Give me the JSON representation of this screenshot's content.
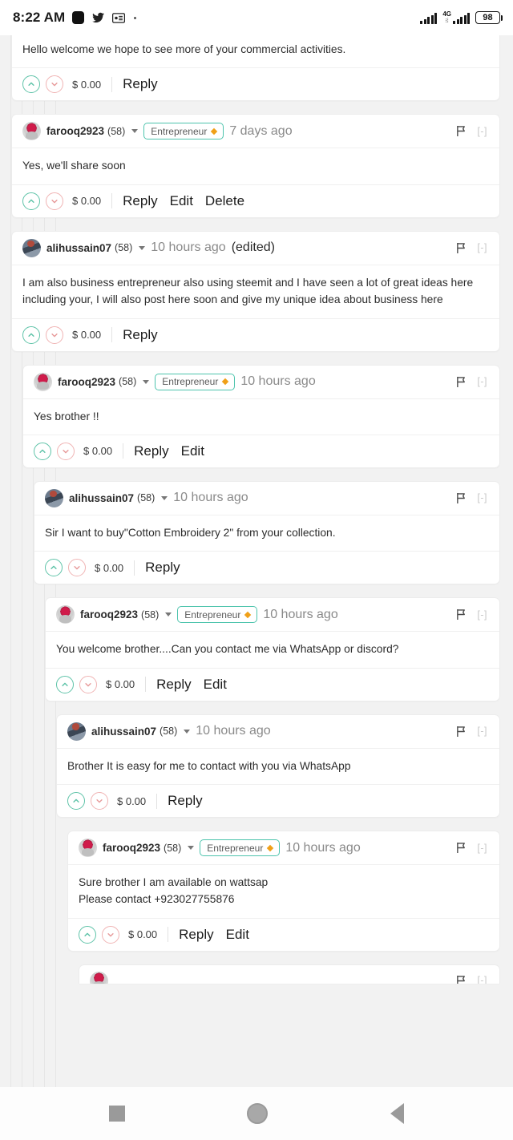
{
  "status_bar": {
    "time": "8:22 AM",
    "battery_percent": "98",
    "network_type": "4G",
    "network_sub": "LTE",
    "icons": [
      "app-square-icon",
      "twitter-icon",
      "id-card-icon",
      "dot-icon"
    ]
  },
  "nav_bar": {
    "recents_label": "recents-button",
    "home_label": "home-button",
    "back_label": "back-button"
  },
  "ui_labels": {
    "reply": "Reply",
    "edit": "Edit",
    "delete": "Delete",
    "collapse": "[-]",
    "flag": "flag-icon",
    "upvote": "upvote-icon",
    "downvote": "downvote-icon",
    "badge_text": "Entrepreneur",
    "edited_tag": "(edited)"
  },
  "colors": {
    "accent_teal": "#4ec4ad",
    "badge_diamond": "#f0a018",
    "upvote_border": "#5ec3a8",
    "downvote_border": "#f0b3b3",
    "page_bg": "#f2f2f2",
    "card_bg": "#ffffff"
  },
  "comments": [
    {
      "id": "c0",
      "partial_top": true,
      "indent": 0,
      "body": "Hello welcome we hope to see more of your commercial activities.",
      "payout": "$ 0.00",
      "actions": [
        "Reply"
      ]
    },
    {
      "id": "c1",
      "indent": 0,
      "author": "farooq2923",
      "reputation": "(58)",
      "avatar": "flower",
      "badge": "Entrepreneur",
      "time": "7 days ago",
      "edited": "",
      "body": "Yes, we'll share soon",
      "payout": "$ 0.00",
      "actions": [
        "Reply",
        "Edit",
        "Delete"
      ]
    },
    {
      "id": "c2",
      "indent": 0,
      "author": "alihussain07",
      "reputation": "(58)",
      "avatar": "person",
      "badge": "",
      "time": "10 hours ago",
      "edited": "(edited)",
      "body": "I am also business entrepreneur also using steemit and I have seen a lot of great ideas here including your, I will also post here soon and give my unique idea about business here",
      "payout": "$ 0.00",
      "actions": [
        "Reply"
      ]
    },
    {
      "id": "c3",
      "indent": 1,
      "author": "farooq2923",
      "reputation": "(58)",
      "avatar": "flower",
      "badge": "Entrepreneur",
      "time": "10 hours ago",
      "edited": "",
      "body": "Yes brother !!",
      "payout": "$ 0.00",
      "actions": [
        "Reply",
        "Edit"
      ]
    },
    {
      "id": "c4",
      "indent": 2,
      "author": "alihussain07",
      "reputation": "(58)",
      "avatar": "person",
      "badge": "",
      "time": "10 hours ago",
      "edited": "",
      "body": "Sir I want to buy\"Cotton Embroidery 2\" from your collection.",
      "payout": "$ 0.00",
      "actions": [
        "Reply"
      ]
    },
    {
      "id": "c5",
      "indent": 3,
      "author": "farooq2923",
      "reputation": "(58)",
      "avatar": "flower",
      "badge": "Entrepreneur",
      "time": "10 hours ago",
      "edited": "",
      "body": "You welcome brother....Can you contact me via WhatsApp or discord?",
      "payout": "$ 0.00",
      "actions": [
        "Reply",
        "Edit"
      ]
    },
    {
      "id": "c6",
      "indent": 4,
      "author": "alihussain07",
      "reputation": "(58)",
      "avatar": "person",
      "badge": "",
      "time": "10 hours ago",
      "edited": "",
      "body": "Brother It is easy for me to contact with you via WhatsApp",
      "payout": "$ 0.00",
      "actions": [
        "Reply"
      ]
    },
    {
      "id": "c7",
      "indent": 5,
      "author": "farooq2923",
      "reputation": "(58)",
      "avatar": "flower",
      "badge": "Entrepreneur",
      "time": "10 hours ago",
      "edited": "",
      "body_line1": "Sure brother I am available on wattsap",
      "body_line2": "Please contact +923027755876",
      "payout": "$ 0.00",
      "actions": [
        "Reply",
        "Edit"
      ]
    },
    {
      "id": "c8",
      "indent": 6,
      "partial_bottom": true,
      "avatar": "flower"
    }
  ]
}
